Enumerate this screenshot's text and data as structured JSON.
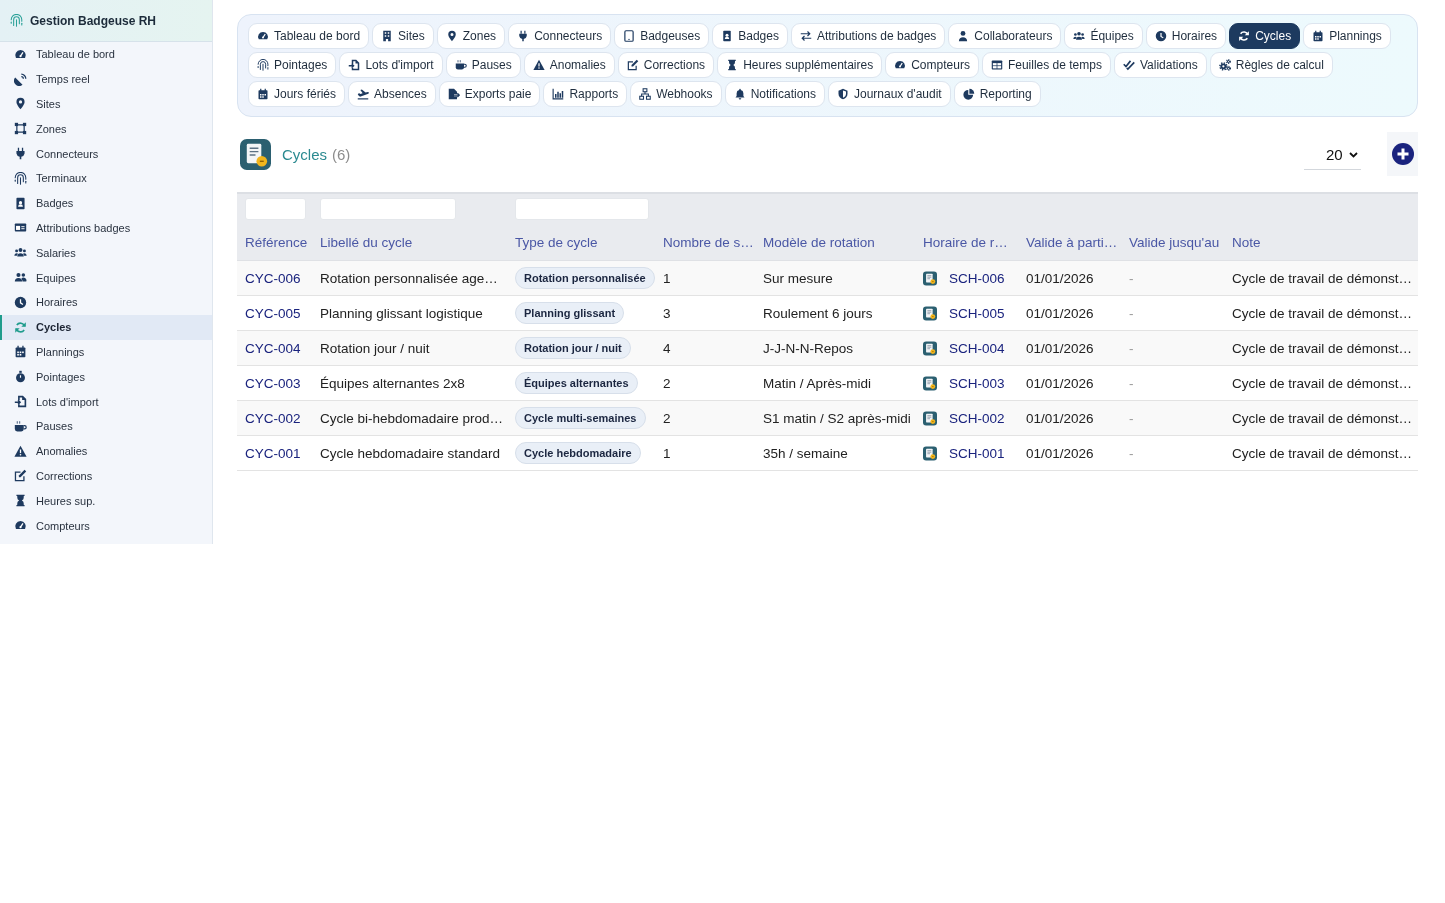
{
  "app": {
    "title": "Gestion Badgeuse RH"
  },
  "sidebar": {
    "items": [
      {
        "label": "Tableau de bord",
        "selected": false
      },
      {
        "label": "Temps reel",
        "selected": false
      },
      {
        "label": "Sites",
        "selected": false
      },
      {
        "label": "Zones",
        "selected": false
      },
      {
        "label": "Connecteurs",
        "selected": false
      },
      {
        "label": "Terminaux",
        "selected": false
      },
      {
        "label": "Badges",
        "selected": false
      },
      {
        "label": "Attributions badges",
        "selected": false
      },
      {
        "label": "Salaries",
        "selected": false
      },
      {
        "label": "Equipes",
        "selected": false
      },
      {
        "label": "Horaires",
        "selected": false
      },
      {
        "label": "Cycles",
        "selected": true
      },
      {
        "label": "Plannings",
        "selected": false
      },
      {
        "label": "Pointages",
        "selected": false
      },
      {
        "label": "Lots d'import",
        "selected": false
      },
      {
        "label": "Pauses",
        "selected": false
      },
      {
        "label": "Anomalies",
        "selected": false
      },
      {
        "label": "Corrections",
        "selected": false
      },
      {
        "label": "Heures sup.",
        "selected": false
      },
      {
        "label": "Compteurs",
        "selected": false
      }
    ]
  },
  "tabs": [
    {
      "label": "Tableau de bord",
      "selected": false
    },
    {
      "label": "Sites",
      "selected": false
    },
    {
      "label": "Zones",
      "selected": false
    },
    {
      "label": "Connecteurs",
      "selected": false
    },
    {
      "label": "Badgeuses",
      "selected": false
    },
    {
      "label": "Badges",
      "selected": false
    },
    {
      "label": "Attributions de badges",
      "selected": false
    },
    {
      "label": "Collaborateurs",
      "selected": false
    },
    {
      "label": "Équipes",
      "selected": false
    },
    {
      "label": "Horaires",
      "selected": false
    },
    {
      "label": "Cycles",
      "selected": true
    },
    {
      "label": "Plannings",
      "selected": false
    },
    {
      "label": "Pointages",
      "selected": false
    },
    {
      "label": "Lots d'import",
      "selected": false
    },
    {
      "label": "Pauses",
      "selected": false
    },
    {
      "label": "Anomalies",
      "selected": false
    },
    {
      "label": "Corrections",
      "selected": false
    },
    {
      "label": "Heures supplémentaires",
      "selected": false
    },
    {
      "label": "Compteurs",
      "selected": false
    },
    {
      "label": "Feuilles de temps",
      "selected": false
    },
    {
      "label": "Validations",
      "selected": false
    },
    {
      "label": "Règles de calcul",
      "selected": false
    },
    {
      "label": "Jours fériés",
      "selected": false
    },
    {
      "label": "Absences",
      "selected": false
    },
    {
      "label": "Exports paie",
      "selected": false
    },
    {
      "label": "Rapports",
      "selected": false
    },
    {
      "label": "Webhooks",
      "selected": false
    },
    {
      "label": "Notifications",
      "selected": false
    },
    {
      "label": "Journaux d'audit",
      "selected": false
    },
    {
      "label": "Reporting",
      "selected": false
    }
  ],
  "page": {
    "title": "Cycles",
    "count": "(6)",
    "page_size": "20"
  },
  "table": {
    "columns": [
      {
        "label": "Référence",
        "kind": "link",
        "filter": true
      },
      {
        "label": "Libellé du cycle",
        "kind": "text",
        "filter": true
      },
      {
        "label": "Type de cycle",
        "kind": "tag",
        "filter": true
      },
      {
        "label": "Nombre de s…",
        "kind": "text",
        "filter": false
      },
      {
        "label": "Modèle de rotation",
        "kind": "text",
        "filter": false
      },
      {
        "label": "Horaire de r…",
        "kind": "schedule-link",
        "filter": false
      },
      {
        "label": "Valide à parti…",
        "kind": "text",
        "filter": false
      },
      {
        "label": "Valide jusqu'au",
        "kind": "muted",
        "filter": false
      },
      {
        "label": "Note",
        "kind": "text",
        "filter": false
      }
    ],
    "rows": [
      [
        "CYC-006",
        "Rotation personnalisée age…",
        "Rotation personnalisée",
        "1",
        "Sur mesure",
        "SCH-006",
        "01/01/2026",
        "-",
        "Cycle de travail de démonst…"
      ],
      [
        "CYC-005",
        "Planning glissant logistique",
        "Planning glissant",
        "3",
        "Roulement 6 jours",
        "SCH-005",
        "01/01/2026",
        "-",
        "Cycle de travail de démonst…"
      ],
      [
        "CYC-004",
        "Rotation jour / nuit",
        "Rotation jour / nuit",
        "4",
        "J-J-N-N-Repos",
        "SCH-004",
        "01/01/2026",
        "-",
        "Cycle de travail de démonst…"
      ],
      [
        "CYC-003",
        "Équipes alternantes 2x8",
        "Équipes alternantes",
        "2",
        "Matin / Après-midi",
        "SCH-003",
        "01/01/2026",
        "-",
        "Cycle de travail de démonst…"
      ],
      [
        "CYC-002",
        "Cycle bi-hebdomadaire prod…",
        "Cycle multi-semaines",
        "2",
        "S1 matin / S2 après-midi",
        "SCH-002",
        "01/01/2026",
        "-",
        "Cycle de travail de démonst…"
      ],
      [
        "CYC-001",
        "Cycle hebdomadaire standard",
        "Cycle hebdomadaire",
        "1",
        "35h / semaine",
        "SCH-001",
        "01/01/2026",
        "-",
        "Cycle de travail de démonst…"
      ]
    ]
  }
}
